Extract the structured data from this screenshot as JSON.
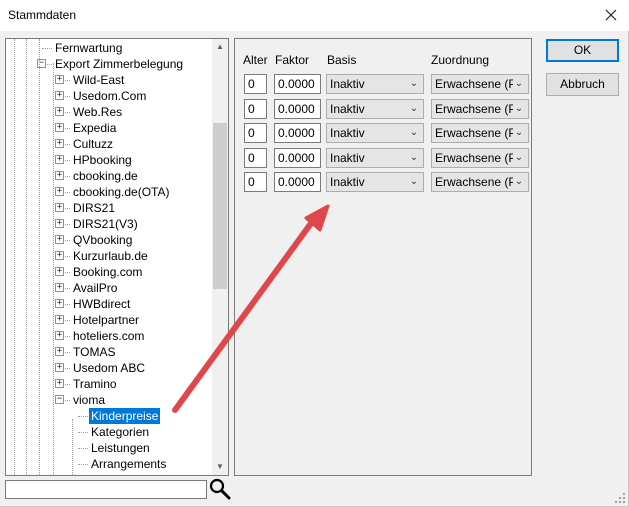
{
  "window": {
    "title": "Stammdaten"
  },
  "tree": {
    "items": [
      {
        "label": "Fernwartung",
        "expander": ""
      },
      {
        "label": "Export Zimmerbelegung",
        "expander": "−"
      },
      {
        "label": "Wild-East",
        "expander": "+"
      },
      {
        "label": "Usedom.Com",
        "expander": "+"
      },
      {
        "label": "Web.Res",
        "expander": "+"
      },
      {
        "label": "Expedia",
        "expander": "+"
      },
      {
        "label": "Cultuzz",
        "expander": "+"
      },
      {
        "label": "HPbooking",
        "expander": "+"
      },
      {
        "label": "cbooking.de",
        "expander": "+"
      },
      {
        "label": "cbooking.de(OTA)",
        "expander": "+"
      },
      {
        "label": "DIRS21",
        "expander": "+"
      },
      {
        "label": "DIRS21(V3)",
        "expander": "+"
      },
      {
        "label": "QVbooking",
        "expander": "+"
      },
      {
        "label": "Kurzurlaub.de",
        "expander": "+"
      },
      {
        "label": "Booking.com",
        "expander": "+"
      },
      {
        "label": "AvailPro",
        "expander": "+"
      },
      {
        "label": "HWBdirect",
        "expander": "+"
      },
      {
        "label": "Hotelpartner",
        "expander": "+"
      },
      {
        "label": "hoteliers.com",
        "expander": "+"
      },
      {
        "label": "TOMAS",
        "expander": "+"
      },
      {
        "label": "Usedom ABC",
        "expander": "+"
      },
      {
        "label": "Tramino",
        "expander": "+"
      },
      {
        "label": "vioma",
        "expander": "−"
      },
      {
        "label": "Kinderpreise",
        "expander": "",
        "selected": true
      },
      {
        "label": "Kategorien",
        "expander": ""
      },
      {
        "label": "Leistungen",
        "expander": ""
      },
      {
        "label": "Arrangements",
        "expander": ""
      }
    ]
  },
  "search": {
    "value": ""
  },
  "grid": {
    "headers": {
      "alter": "Alter",
      "faktor": "Faktor",
      "basis": "Basis",
      "zuordnung": "Zuordnung"
    },
    "rows": [
      {
        "alter": "0",
        "faktor": "0.0000",
        "basis": "Inaktiv",
        "zuordnung": "Erwachsene (P:"
      },
      {
        "alter": "0",
        "faktor": "0.0000",
        "basis": "Inaktiv",
        "zuordnung": "Erwachsene (P:"
      },
      {
        "alter": "0",
        "faktor": "0.0000",
        "basis": "Inaktiv",
        "zuordnung": "Erwachsene (P:"
      },
      {
        "alter": "0",
        "faktor": "0.0000",
        "basis": "Inaktiv",
        "zuordnung": "Erwachsene (P:"
      },
      {
        "alter": "0",
        "faktor": "0.0000",
        "basis": "Inaktiv",
        "zuordnung": "Erwachsene (P:"
      }
    ]
  },
  "buttons": {
    "ok": "OK",
    "cancel": "Abbruch"
  },
  "colors": {
    "selection": "#0078d7",
    "annotation_arrow": "#e0474c"
  },
  "icons": {
    "close": "close-icon",
    "search": "search-icon",
    "scroll_up": "chevron-up-icon",
    "scroll_down": "chevron-down-icon"
  }
}
